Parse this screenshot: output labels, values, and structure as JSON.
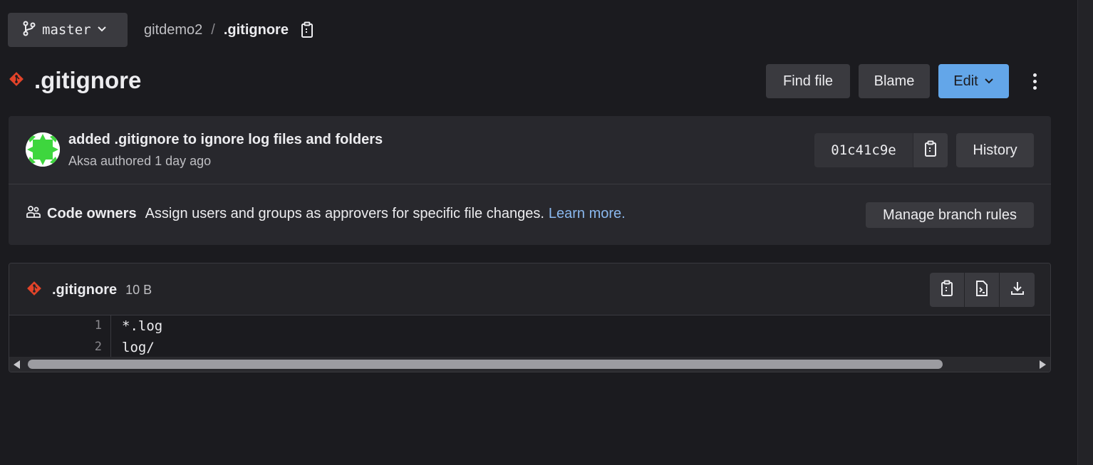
{
  "colors": {
    "background": "#1b1b1f",
    "panel": "#28282d",
    "button": "#3a3a3f",
    "primary_button": "#63a6e9",
    "link": "#8ab8ee",
    "file_icon": "#e24329",
    "avatar_green": "#3ed63e"
  },
  "branch_selector": {
    "label": "master",
    "icon": "branch-icon"
  },
  "breadcrumb": {
    "project": "gitdemo2",
    "separator": "/",
    "current": ".gitignore",
    "copy_icon": "copy-path-icon"
  },
  "header": {
    "title": ".gitignore",
    "find_file_label": "Find file",
    "blame_label": "Blame",
    "edit_label": "Edit",
    "more_icon": "more-vertical-icon"
  },
  "commit": {
    "title": "added .gitignore to ignore log files and folders",
    "meta": "Aksa authored 1 day ago",
    "sha": "01c41c9e",
    "history_label": "History"
  },
  "code_owners": {
    "label": "Code owners",
    "description": "Assign users and groups as approvers for specific file changes.",
    "learn_more": "Learn more.",
    "manage_label": "Manage branch rules"
  },
  "file_viewer": {
    "name": ".gitignore",
    "size": "10 B",
    "lines": [
      {
        "number": "1",
        "text": "*.log"
      },
      {
        "number": "2",
        "text": "log/"
      }
    ]
  }
}
